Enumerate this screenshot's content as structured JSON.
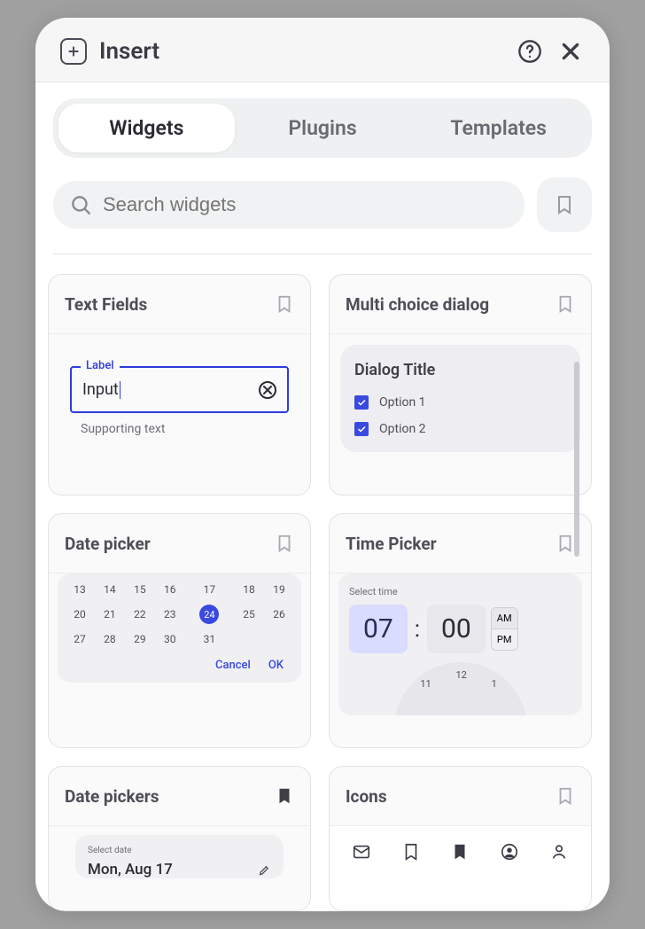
{
  "header": {
    "title": "Insert"
  },
  "tabs": [
    "Widgets",
    "Plugins",
    "Templates"
  ],
  "active_tab": 0,
  "search": {
    "placeholder": "Search widgets"
  },
  "cards": {
    "text_fields": {
      "title": "Text Fields",
      "bookmarked": false,
      "field": {
        "label": "Label",
        "value": "Input",
        "supporting": "Supporting text"
      }
    },
    "multi_choice": {
      "title": "Multi choice dialog",
      "bookmarked": false,
      "dialog_title": "Dialog Title",
      "options": [
        "Option 1",
        "Option 2"
      ]
    },
    "date_picker": {
      "title": "Date picker",
      "bookmarked": false,
      "rows": [
        [
          "13",
          "14",
          "15",
          "16",
          "17",
          "18",
          "19"
        ],
        [
          "20",
          "21",
          "22",
          "23",
          "24",
          "25",
          "26"
        ],
        [
          "27",
          "28",
          "29",
          "30",
          "31",
          "",
          ""
        ]
      ],
      "selected": "24",
      "cancel": "Cancel",
      "ok": "OK"
    },
    "time_picker": {
      "title": "Time Picker",
      "bookmarked": false,
      "label": "Select time",
      "hour": "07",
      "minute": "00",
      "am": "AM",
      "pm": "PM",
      "dial": [
        "11",
        "12",
        "1"
      ]
    },
    "date_pickers": {
      "title": "Date pickers",
      "bookmarked": true,
      "label": "Select date",
      "value": "Mon, Aug 17"
    },
    "icons": {
      "title": "Icons",
      "bookmarked": false
    }
  }
}
